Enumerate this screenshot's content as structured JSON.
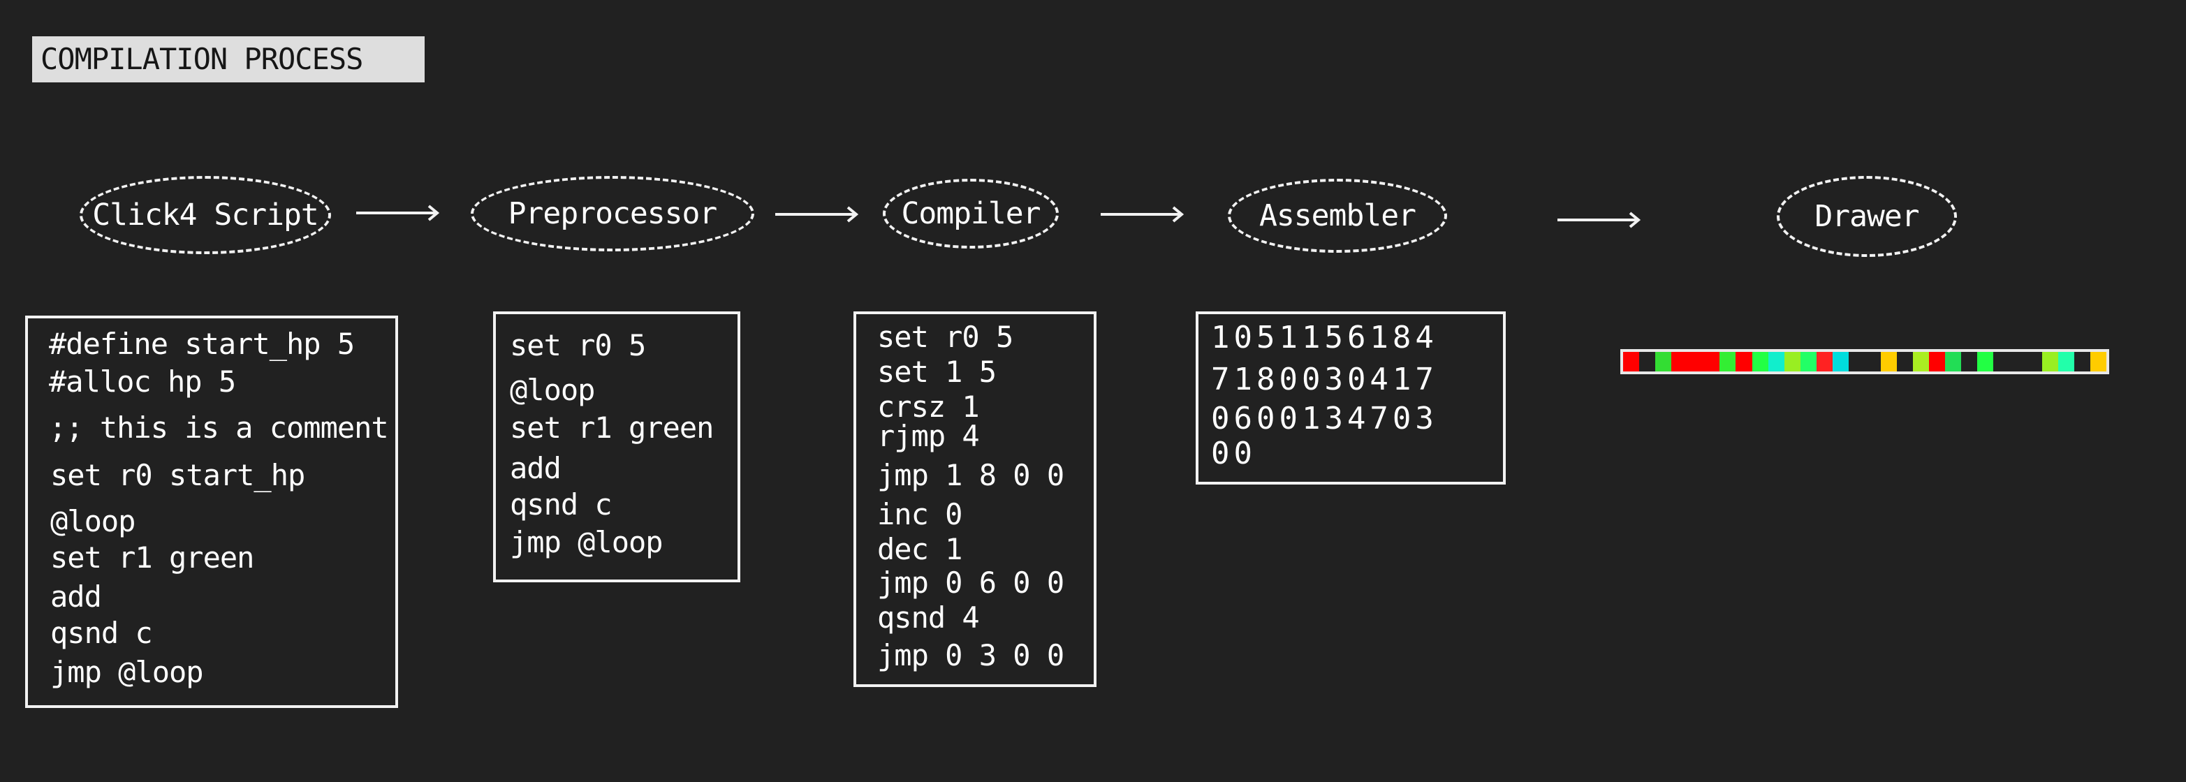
{
  "title": "COMPILATION PROCESS",
  "stages": [
    {
      "label": "Click4 Script"
    },
    {
      "label": "Preprocessor"
    },
    {
      "label": "Compiler"
    },
    {
      "label": "Assembler"
    },
    {
      "label": "Drawer"
    }
  ],
  "script_code": [
    "#define start_hp 5",
    "#alloc hp 5",
    ";; this is a comment",
    "set r0 start_hp",
    "@loop",
    "set r1 green",
    "add",
    "qsnd c",
    "jmp @loop"
  ],
  "preprocessed_code": [
    "set r0 5",
    "@loop",
    "set r1 green",
    "add",
    "qsnd c",
    "jmp @loop"
  ],
  "compiled_code": [
    "set r0 5",
    "set 1 5",
    "crsz 1",
    "rjmp 4",
    "jmp 1 8 0 0",
    "inc 0",
    "dec 1",
    "jmp 0 6 0 0",
    "qsnd 4",
    "jmp 0 3 0 0"
  ],
  "assembled_digits": [
    "1051156184",
    "7180030417",
    "0600134703",
    "00"
  ],
  "drawer_colors": [
    "#ff0000",
    "#222222",
    "#33dd33",
    "#ff0000",
    "#ff0000",
    "#ff0000",
    "#33ee33",
    "#ff0000",
    "#22ff44",
    "#11eecc",
    "#99ee22",
    "#22ff66",
    "#ff2222",
    "#00dddd",
    "#222222",
    "#222222",
    "#ffcc00",
    "#222222",
    "#aaee22",
    "#ff0000",
    "#22dd55",
    "#222222",
    "#22ff44",
    "#222222",
    "#222222",
    "#222222",
    "#99ee22",
    "#22ffaa",
    "#222222",
    "#ffcc00"
  ]
}
